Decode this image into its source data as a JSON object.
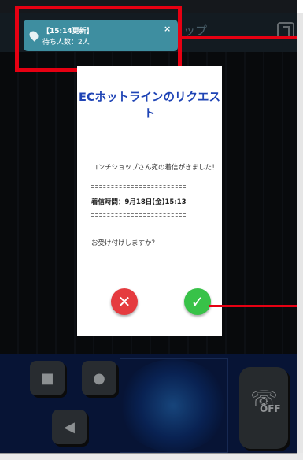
{
  "app": {
    "title": "コンチショップ",
    "controls": {
      "camera_icon": "video-camera-icon",
      "mic_icon": "microphone-icon",
      "speaker_icon": "speaker-icon",
      "off_label": "OFF"
    }
  },
  "notification": {
    "line1": "【15:14更新】",
    "line2": "待ち人数：2人",
    "close": "×"
  },
  "dialog": {
    "title": "ECホットラインのリクエスト",
    "message": "コンチショップさん宛の着信がきました！",
    "separator": "================================",
    "time_text": "着信時間：9月18日(金)15:13",
    "question": "お受け付けしますか？",
    "reject_symbol": "✕",
    "accept_symbol": "✓"
  },
  "colors": {
    "annotation_red": "#e60012",
    "title_blue": "#1f44b5",
    "reject_red": "#e53b3f",
    "accept_green": "#38c248",
    "toast_teal": "#3e8ea0"
  }
}
